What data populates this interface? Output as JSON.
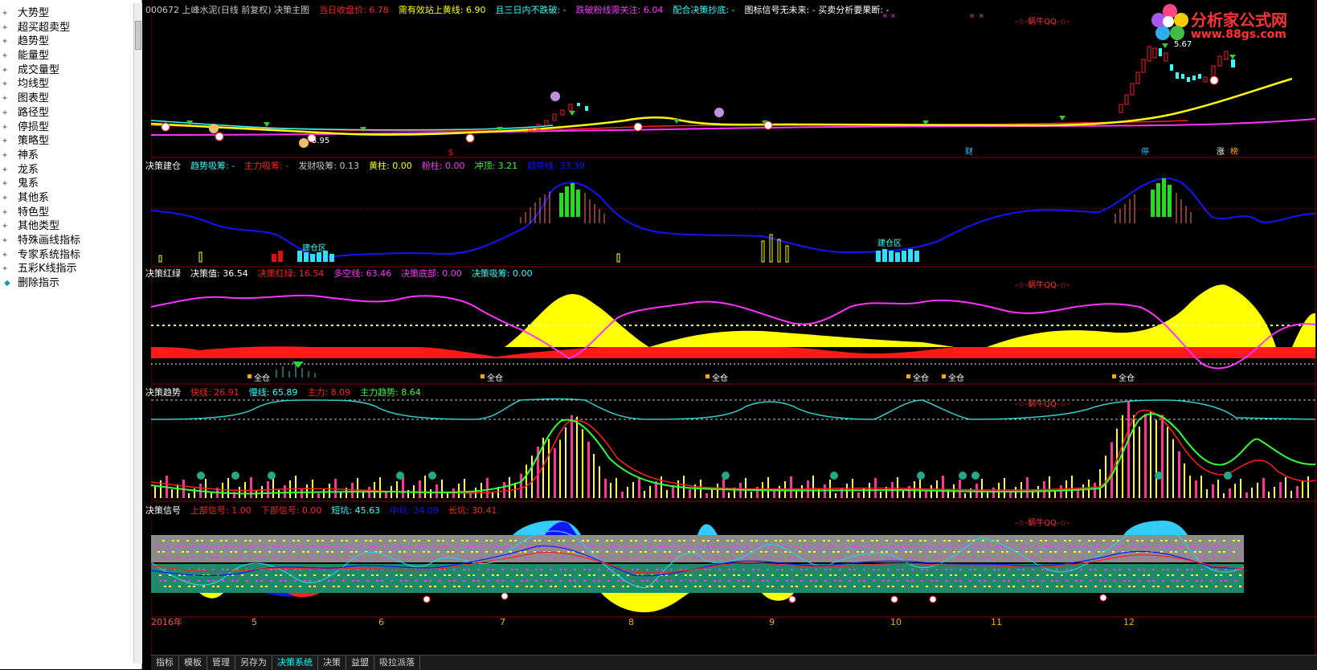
{
  "sidebar": {
    "items": [
      {
        "label": "大势型",
        "expand": "+"
      },
      {
        "label": "超买超卖型",
        "expand": "+"
      },
      {
        "label": "趋势型",
        "expand": "+"
      },
      {
        "label": "能量型",
        "expand": "+"
      },
      {
        "label": "成交量型",
        "expand": "+"
      },
      {
        "label": "均线型",
        "expand": "+"
      },
      {
        "label": "图表型",
        "expand": "+"
      },
      {
        "label": "路径型",
        "expand": "+"
      },
      {
        "label": "停损型",
        "expand": "+"
      },
      {
        "label": "策略型",
        "expand": "+"
      },
      {
        "label": "神系",
        "expand": "+"
      },
      {
        "label": "龙系",
        "expand": "+"
      },
      {
        "label": "鬼系",
        "expand": "+"
      },
      {
        "label": "其他系",
        "expand": "+"
      },
      {
        "label": "特色型",
        "expand": "+"
      },
      {
        "label": "其他类型",
        "expand": "+"
      },
      {
        "label": "特殊画线指标",
        "expand": "+"
      },
      {
        "label": "专家系统指标",
        "expand": "+"
      },
      {
        "label": "五彩K线指示",
        "expand": "+"
      },
      {
        "label": "删除指示",
        "expand": "◆"
      }
    ]
  },
  "logo": {
    "title": "分析家公式网",
    "url": "www.88gs.com"
  },
  "colors": {
    "yellow": "#ffff00",
    "red": "#ff2020",
    "magenta": "#ff33ff",
    "cyan": "#33ffff",
    "green": "#33ff33",
    "blue": "#1414ff",
    "white": "#ffffff",
    "grey": "#c8c8c8",
    "pink": "#ff3399"
  },
  "panels": {
    "main": {
      "labels": [
        {
          "text": "000672 上峰水泥(日线 前复权) 决策主图",
          "color": "grey"
        },
        {
          "text": "当日收盘价: 6.78",
          "color": "red"
        },
        {
          "text": "需有效站上黄线: 6.90",
          "color": "yellow"
        },
        {
          "text": "且三日内不跌破: -",
          "color": "cyan"
        },
        {
          "text": "跌破粉线需关注: 6.04",
          "color": "magenta"
        },
        {
          "text": "配合决策抄底: -",
          "color": "cyan"
        },
        {
          "text": "图标信号无未来: - 买卖分析要果断: -",
          "color": "white"
        }
      ],
      "watermark": "-☆-蜗牛QQ-☆-",
      "price_markers": [
        "5.67",
        "5.95",
        "$"
      ],
      "captions": [
        "财",
        "停",
        "涨",
        "榜"
      ]
    },
    "jiancang": {
      "labels": [
        {
          "text": "决策建仓",
          "color": "white"
        },
        {
          "text": "趋势吸筹: -",
          "color": "cyan"
        },
        {
          "text": "主力吸筹: -",
          "color": "red"
        },
        {
          "text": "发财吸筹: 0.13",
          "color": "grey"
        },
        {
          "text": "黄柱: 0.00",
          "color": "yellow"
        },
        {
          "text": "粉柱: 0.00",
          "color": "magenta"
        },
        {
          "text": "冲顶: 3.21",
          "color": "green"
        },
        {
          "text": "趋势线: 33.39",
          "color": "blue"
        }
      ],
      "annotations": [
        "建仓区",
        "建仓区"
      ]
    },
    "honglv": {
      "labels": [
        {
          "text": "决策红绿",
          "color": "white"
        },
        {
          "text": "决策值: 36.54",
          "color": "white"
        },
        {
          "text": "决策红绿: 16.54",
          "color": "red"
        },
        {
          "text": "多空线: 63.46",
          "color": "magenta"
        },
        {
          "text": "决策底部: 0.00",
          "color": "magenta"
        },
        {
          "text": "决策吸筹: 0.00",
          "color": "cyan"
        }
      ],
      "watermark": "-☆-蜗牛QQ-☆-",
      "annotations": [
        "全仓",
        "全仓",
        "全仓",
        "全仓",
        "全仓",
        "全仓"
      ]
    },
    "qushi": {
      "labels": [
        {
          "text": "决策趋势",
          "color": "white"
        },
        {
          "text": "快线: 26.91",
          "color": "red"
        },
        {
          "text": "慢线: 65.89",
          "color": "cyan"
        },
        {
          "text": "主力: 8.09",
          "color": "red"
        },
        {
          "text": "主力趋势: 8.64",
          "color": "green"
        }
      ],
      "watermark": "-☆-蜗牛QQ-☆-"
    },
    "xinhao": {
      "labels": [
        {
          "text": "决策信号",
          "color": "white"
        },
        {
          "text": "上部信号: 1.00",
          "color": "red"
        },
        {
          "text": "下部信号: 0.00",
          "color": "red"
        },
        {
          "text": "短坑: 45.63",
          "color": "cyan"
        },
        {
          "text": "中坑: 34.09",
          "color": "blue"
        },
        {
          "text": "长坑: 30.41",
          "color": "red"
        }
      ],
      "watermark": "-☆-蜗牛QQ-☆-"
    }
  },
  "xaxis": [
    "2016年",
    "5",
    "6",
    "7",
    "8",
    "9",
    "10",
    "11",
    "12"
  ],
  "tabs": [
    {
      "label": "指标",
      "active": false
    },
    {
      "label": "模板",
      "active": false
    },
    {
      "label": "管理",
      "active": false
    },
    {
      "label": "另存为",
      "active": false
    },
    {
      "label": "决策系统",
      "active": true
    },
    {
      "label": "决策",
      "active": false
    },
    {
      "label": "益盟",
      "active": false
    },
    {
      "label": "吸拉派落",
      "active": false
    }
  ]
}
